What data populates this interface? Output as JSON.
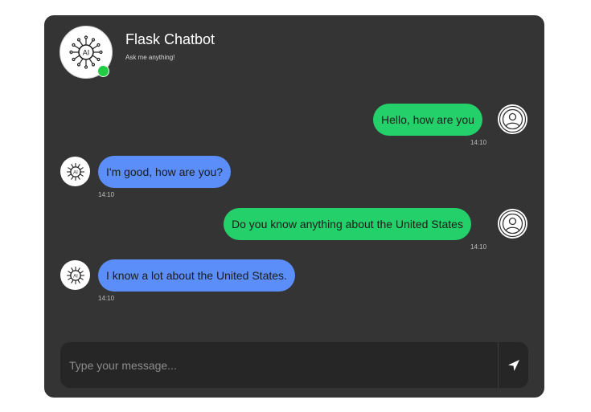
{
  "header": {
    "title": "Flask Chatbot",
    "subtitle": "Ask me anything!",
    "status": "online"
  },
  "messages": [
    {
      "sender": "user",
      "text": "Hello, how are you",
      "time": "14:10"
    },
    {
      "sender": "bot",
      "text": "I'm good, how are you?",
      "time": "14:10"
    },
    {
      "sender": "user",
      "text": "Do you know anything about the United States",
      "time": "14:10"
    },
    {
      "sender": "bot",
      "text": "I know a lot about the United States.",
      "time": "14:10"
    }
  ],
  "input": {
    "placeholder": "Type your message...",
    "value": ""
  },
  "icons": {
    "bot_avatar": "ai-chip-icon",
    "user_avatar": "user-avatar-icon",
    "send": "send-arrow-icon"
  },
  "colors": {
    "card_bg": "#343434",
    "user_bubble": "#24d06a",
    "bot_bubble": "#5b8ef8",
    "online": "#22cc44",
    "input_bg": "#262626"
  }
}
